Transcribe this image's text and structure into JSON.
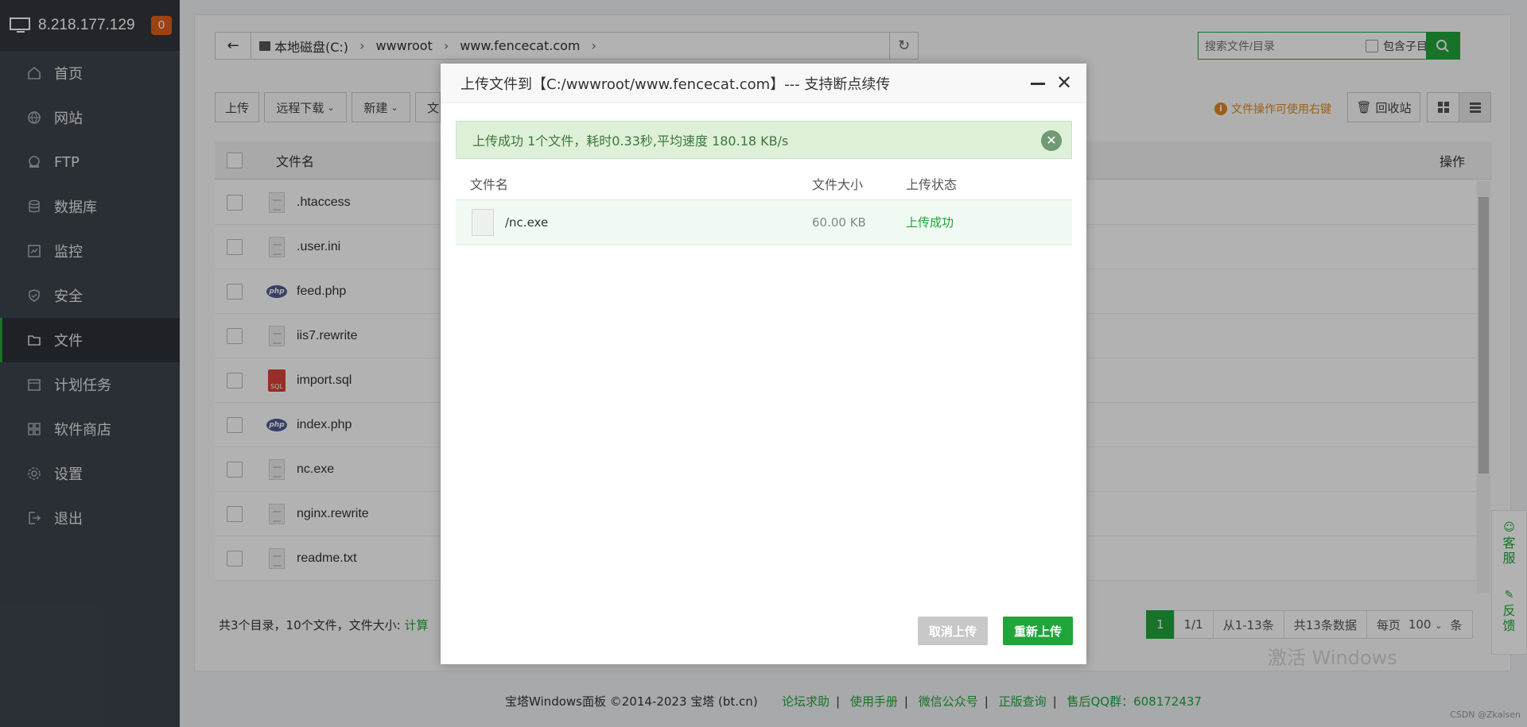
{
  "sidebar": {
    "ip": "8.218.177.129",
    "badge": "0",
    "items": [
      {
        "label": "首页",
        "icon": "home-icon"
      },
      {
        "label": "网站",
        "icon": "globe-icon"
      },
      {
        "label": "FTP",
        "icon": "ftp-icon"
      },
      {
        "label": "数据库",
        "icon": "database-icon"
      },
      {
        "label": "监控",
        "icon": "monitor-icon"
      },
      {
        "label": "安全",
        "icon": "shield-icon"
      },
      {
        "label": "文件",
        "icon": "folder-icon"
      },
      {
        "label": "计划任务",
        "icon": "calendar-icon"
      },
      {
        "label": "软件商店",
        "icon": "grid-icon"
      },
      {
        "label": "设置",
        "icon": "gear-icon"
      },
      {
        "label": "退出",
        "icon": "logout-icon"
      }
    ],
    "active_index": 6
  },
  "path": {
    "crumbs": [
      "本地磁盘(C:)",
      "wwwroot",
      "www.fencecat.com"
    ]
  },
  "search": {
    "placeholder": "搜索文件/目录",
    "subdir_label": "包含子目录"
  },
  "toolbar": {
    "upload": "上传",
    "remote_download": "远程下载",
    "new": "新建",
    "more": "文",
    "tip": "文件操作可使用右键",
    "recycle": "回收站"
  },
  "table": {
    "col_name": "文件名",
    "col_action": "操作",
    "files": [
      {
        "name": ".htaccess",
        "type": "doc"
      },
      {
        "name": ".user.ini",
        "type": "doc"
      },
      {
        "name": "feed.php",
        "type": "php"
      },
      {
        "name": "iis7.rewrite",
        "type": "doc"
      },
      {
        "name": "import.sql",
        "type": "sql"
      },
      {
        "name": "index.php",
        "type": "php"
      },
      {
        "name": "nc.exe",
        "type": "doc"
      },
      {
        "name": "nginx.rewrite",
        "type": "doc"
      },
      {
        "name": "readme.txt",
        "type": "doc"
      }
    ]
  },
  "footer": {
    "summary": "共3个目录，10个文件，文件大小:",
    "calc": "计算",
    "pager": {
      "current": "1",
      "pages": "1/1",
      "range": "从1-13条",
      "total": "共13条数据",
      "per_page_label": "每页",
      "per_page": "100",
      "unit": "条"
    }
  },
  "copyright": {
    "text": "宝塔Windows面板 ©2014-2023 宝塔 (bt.cn)",
    "links": [
      "论坛求助",
      "使用手册",
      "微信公众号",
      "正版查询",
      "售后QQ群：608172437"
    ]
  },
  "side_float": {
    "service": "客服",
    "feedback": "反馈"
  },
  "watermark": "激活 Windows",
  "csdn": "CSDN @Zkaisen",
  "dialog": {
    "title": "上传文件到【C:/wwwroot/www.fencecat.com】--- 支持断点续传",
    "alert": "上传成功 1个文件，耗时0.33秒,平均速度 180.18 KB/s",
    "col_name": "文件名",
    "col_size": "文件大小",
    "col_status": "上传状态",
    "row": {
      "name": "/nc.exe",
      "size": "60.00 KB",
      "status": "上传成功"
    },
    "cancel": "取消上传",
    "reupload": "重新上传"
  },
  "colors": {
    "accent": "#20a53a",
    "sidebar_bg": "#3d444d",
    "badge": "#e35d1a",
    "tip": "#e08a1e"
  }
}
